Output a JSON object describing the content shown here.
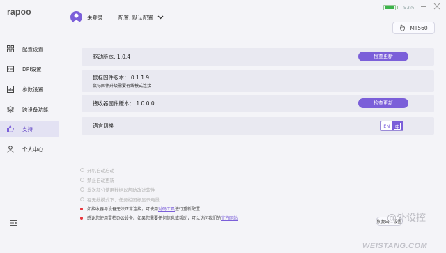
{
  "app": {
    "logo": "rapoo"
  },
  "sidebar": {
    "items": [
      {
        "label": "配置设置",
        "icon": "grid-icon",
        "active": false
      },
      {
        "label": "DPI设置",
        "icon": "dpi-icon",
        "active": false
      },
      {
        "label": "参数设置",
        "icon": "chart-icon",
        "active": false
      },
      {
        "label": "跨设备功能",
        "icon": "layers-icon",
        "active": false
      },
      {
        "label": "支持",
        "icon": "thumbs-up-icon",
        "active": true
      },
      {
        "label": "个人中心",
        "icon": "person-icon",
        "active": false
      }
    ],
    "collapse_icon": "menu-collapse-icon"
  },
  "header": {
    "login_status": "未登录",
    "config_label": "配置: 默认配置",
    "battery": {
      "percent_text": "93%",
      "level": 0.93,
      "color": "#3cb44a"
    },
    "device_name": "MT560"
  },
  "main": {
    "driver_version": "驱动版本: 1.0.4",
    "firmware_version": "鼠标固件版本： 0.1.1.9",
    "firmware_note": "鼠标固件升级需要有线模式连接",
    "receiver_version": "接收器固件版本： 1.0.0.0",
    "check_update_label": "检查更新",
    "language_label": "语言切换",
    "lang_en": "EN",
    "lang_zh": "中",
    "options": [
      "开机自动启动",
      "禁止自动更新",
      "发送部分使用数据以帮助改进软件",
      "在无线模式下，任务栏图标显示电量"
    ],
    "notes": [
      {
        "before": "如接收器与设备无法正常连接，可使用",
        "link": "对码工具",
        "after": "进行重新配置"
      },
      {
        "before": "感谢您使用雷柏办公设备。如果您需要任何信息或帮助，可以访问我们的",
        "link": "官方网站",
        "after": ""
      }
    ],
    "reset_label": "恢复出厂设置"
  },
  "watermark": {
    "line1": "@外设控",
    "line2": "WEISTANG.COM"
  },
  "colors": {
    "accent": "#7b5fd9",
    "active_bg": "#e3e2f3",
    "alert": "#e8343c"
  }
}
